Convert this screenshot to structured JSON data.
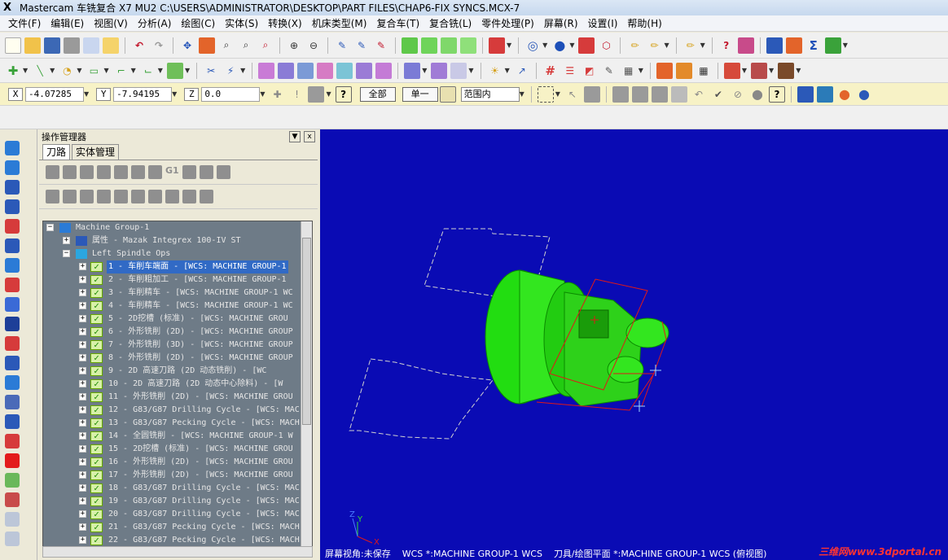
{
  "window": {
    "title": "Mastercam 车铣复合 X7 MU2  C:\\USERS\\ADMINISTRATOR\\DESKTOP\\PART FILES\\CHAP6-FIX SYNCS.MCX-7"
  },
  "menu": [
    "文件(F)",
    "编辑(E)",
    "视图(V)",
    "分析(A)",
    "绘图(C)",
    "实体(S)",
    "转换(X)",
    "机床类型(M)",
    "复合车(T)",
    "复合铣(L)",
    "零件处理(P)",
    "屏幕(R)",
    "设置(I)",
    "帮助(H)"
  ],
  "coords": {
    "x_label": "X",
    "x_value": "-4.07285",
    "y_label": "Y",
    "y_value": "-7.94195",
    "z_label": "Z",
    "z_value": "0.0"
  },
  "selectbar": {
    "all_label": "全部",
    "single_label": "单一",
    "range_value": "范围内"
  },
  "panel": {
    "title": "操作管理器",
    "close": "x",
    "tabs": [
      "刀路",
      "实体管理"
    ]
  },
  "tree": {
    "group": "Machine Group-1",
    "props": "属性 - Mazak Integrex 100-IV ST",
    "spindle": "Left Spindle Ops",
    "ops": [
      "1 - 车削车端面 - [WCS: MACHINE GROUP-1",
      "2 - 车削粗加工 - [WCS: MACHINE GROUP-1",
      "3 - 车削精车 - [WCS: MACHINE GROUP-1 WC",
      "4 - 车削精车 - [WCS: MACHINE GROUP-1 WC",
      "5 - 2D挖槽 (标准) - [WCS: MACHINE GROU",
      "6 - 外形铣削 (2D) - [WCS: MACHINE GROUP",
      "7 - 外形铣削 (3D) - [WCS: MACHINE GROUP",
      "8 - 外形铣削 (2D) - [WCS: MACHINE GROUP",
      "9 - 2D 高速刀路 (2D 动态铣削) - [WC",
      "10 - 2D 高速刀路 (2D 动态中心除料) - [W",
      "11 - 外形铣削 (2D) - [WCS: MACHINE GROU",
      "12 - G83/G87 Drilling Cycle - [WCS: MAC",
      "13 - G83/G87 Pecking Cycle - [WCS: MACH",
      "14 - 全圆铣削 - [WCS: MACHINE GROUP-1 W",
      "15 - 2D挖槽 (标准) - [WCS: MACHINE GROU",
      "16 - 外形铣削 (2D) - [WCS: MACHINE GROU",
      "17 - 外形铣削 (2D) - [WCS: MACHINE GROU",
      "18 - G83/G87 Drilling Cycle - [WCS: MAC",
      "19 - G83/G87 Drilling Cycle - [WCS: MAC",
      "20 - G83/G87 Drilling Cycle - [WCS: MAC",
      "21 - G83/G87 Pecking Cycle - [WCS: MACH",
      "22 - G83/G87 Pecking Cycle - [WCS: MACH"
    ]
  },
  "status": {
    "view": "屏幕视角:未保存",
    "wcs": "WCS *:MACHINE GROUP-1 WCS",
    "plane": "刀具/绘图平面 *:MACHINE GROUP-1 WCS (俯视图)"
  },
  "watermark": "三维网www.3dportal.cn",
  "colors": {
    "viewport": "#0a0bb4",
    "part": "#22dd11",
    "selection": "#316ac5"
  }
}
